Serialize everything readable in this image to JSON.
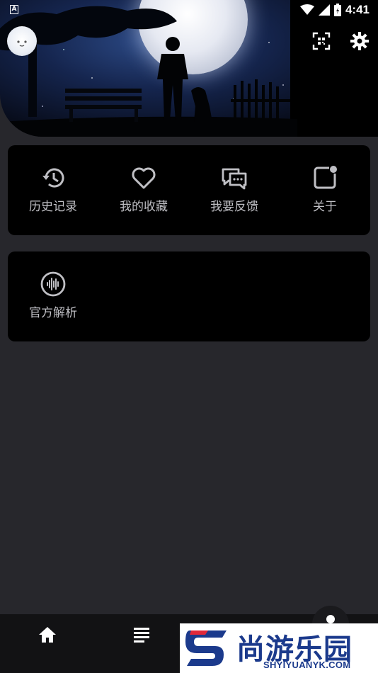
{
  "status_bar": {
    "time": "4:41",
    "notification_icon": "A"
  },
  "header": {
    "avatar_icon": "cloud-avatar-icon",
    "scan_icon": "qr-scan-icon",
    "settings_icon": "gear-icon"
  },
  "menu": {
    "items": [
      {
        "label": "历史记录",
        "icon": "history-icon"
      },
      {
        "label": "我的收藏",
        "icon": "heart-icon"
      },
      {
        "label": "我要反馈",
        "icon": "feedback-icon"
      },
      {
        "label": "关于",
        "icon": "about-icon"
      }
    ]
  },
  "tools": {
    "items": [
      {
        "label": "官方解析",
        "icon": "audio-wave-icon"
      }
    ]
  },
  "bottom_nav": {
    "home_icon": "home-icon",
    "list_icon": "list-icon"
  },
  "watermark": {
    "title": "尚游乐园",
    "subtitle": "SHYIYUANYK.COM"
  },
  "colors": {
    "background": "#27272c",
    "card": "#000000",
    "icon": "#bfbfc4",
    "watermark_blue": "#1b3a8c",
    "watermark_red": "#e0283a"
  }
}
